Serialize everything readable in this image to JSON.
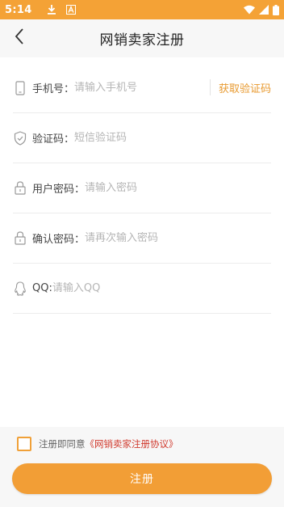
{
  "status_bar": {
    "time": "5:14",
    "background_color": "#F4A236",
    "left_icons": [
      "download-icon",
      "font-a-icon"
    ],
    "right_icons": [
      "wifi-icon",
      "signal-icon",
      "battery-icon"
    ]
  },
  "nav": {
    "title": "网销卖家注册",
    "back_icon": "chevron-left-icon"
  },
  "form": {
    "phone": {
      "label": "手机号：",
      "placeholder": "请输入手机号",
      "icon": "phone-icon"
    },
    "get_code_label": "获取验证码",
    "code": {
      "label": "验证码：",
      "placeholder": "短信验证码",
      "icon": "shield-icon"
    },
    "password": {
      "label": "用户密码：",
      "placeholder": "请输入密码",
      "icon": "lock-icon"
    },
    "confirm_password": {
      "label": "确认密码：",
      "placeholder": "请再次输入密码",
      "icon": "lock-icon"
    },
    "qq": {
      "label": "QQ:",
      "placeholder": "请输入QQ",
      "icon": "qq-icon"
    }
  },
  "agreement": {
    "prefix": "注册即同意",
    "link": "《网销卖家注册协议》",
    "checked": false
  },
  "submit_label": "注册",
  "colors": {
    "accent": "#F29E36",
    "link": "#D03A2E",
    "get_code": "#E89A30"
  }
}
